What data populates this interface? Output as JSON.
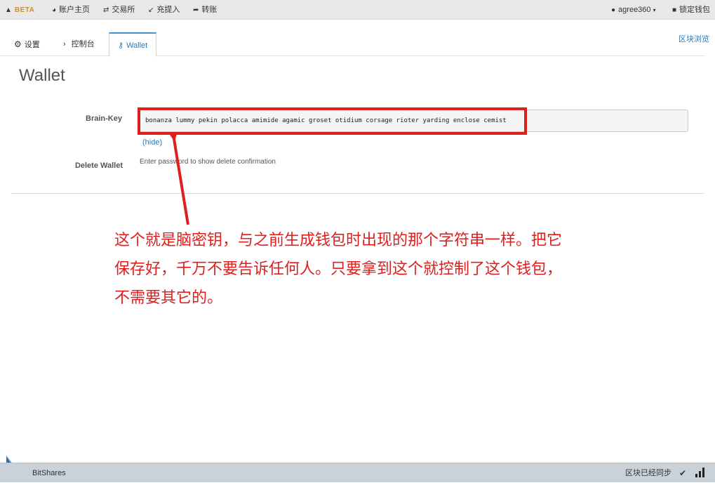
{
  "topbar": {
    "beta": "BETA",
    "account_home": "账户主页",
    "exchange": "交易所",
    "transfer_in": "充提入",
    "transfer": "转账",
    "account_name": "agree360",
    "lock_wallet": "锁定钱包"
  },
  "tabs": {
    "settings": "设置",
    "console": "控制台",
    "wallet": "Wallet"
  },
  "explorer_link": "区块浏览",
  "page": {
    "title": "Wallet",
    "brainkey_label": "Brain-Key",
    "brainkey_value": "bonanza lummy pekin polacca amimide agamic groset otidium corsage rioter yarding enclose cemist",
    "hide_link": "(hide)",
    "delete_label": "Delete Wallet",
    "delete_hint": "Enter password to show delete confirmation"
  },
  "annotation": {
    "line1": "这个就是脑密钥，与之前生成钱包时出现的那个字符串一样。把它",
    "line2": "保存好，千万不要告诉任何人。只要拿到这个就控制了这个钱包，",
    "line3": "不需要其它的。"
  },
  "footer": {
    "brand": "BitShares",
    "sync_status": "区块已经同步"
  },
  "colors": {
    "annotation_red": "#e01e1e",
    "link_blue": "#2a7ab8",
    "beta_gold": "#c8913f"
  }
}
